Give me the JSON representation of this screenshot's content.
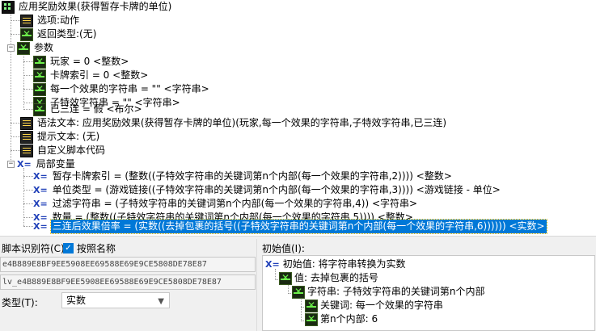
{
  "tree": {
    "function": "应用奖励效果(获得暂存卡牌的单位)",
    "option": "选项:动作",
    "return_type": "返回类型:(无)",
    "params_header": "参数",
    "params": [
      "玩家 = 0 <整数>",
      "卡牌索引 = 0 <整数>",
      "每一个效果的字符串 = \"\" <字符串>",
      "子特效字符串 = \"\" <字符串>",
      "已三连 = 假 <布尔>"
    ],
    "syntax": "语法文本: 应用奖励效果(获得暂存卡牌的单位)(玩家,每一个效果的字符串,子特效字符串,已三连)",
    "hint": "提示文本: (无)",
    "custom_script": "自定义脚本代码",
    "locals_header": "局部变量",
    "locals": [
      "暂存卡牌索引 = (整数((子特效字符串的关键词第n个内部(每一个效果的字符串,2)))) <整数>",
      "单位类型 = (游戏链接((子特效字符串的关键词第n个内部(每一个效果的字符串,3)))) <游戏链接 - 单位>",
      "过滤字符串 = (子特效字符串的关键词第n个内部(每一个效果的字符串,4)) <字符串>",
      "数量 = (整数((子特效字符串的关键词第n个内部(每一个效果的字符串,5)))) <整数>",
      "三连后效果倍率 = (实数((去掉包裹的括号((子特效字符串的关键词第n个内部(每一个效果的字符串,6)))))) <实数>"
    ],
    "xeq": "X="
  },
  "left": {
    "script_id_label": "脚本识别符(C):",
    "by_name_label": "按照名称",
    "id_value": "e4B889E8BF9EE5908EE69588E69E9CE5808DE78E87",
    "lv_value": "lv_e4B889E8BF9EE5908EE69588E69E9CE5808DE78E87",
    "type_label": "类型(T):",
    "type_value": "实数"
  },
  "right": {
    "initial_label": "初始值(I):",
    "rows": [
      "初始值: 将字符串转换为实数",
      "值: 去掉包裹的括号",
      "字符串: 子特效字符串的关键词第n个内部",
      "关键词: 每一个效果的字符串",
      "第n个内部: 6"
    ]
  },
  "colors": {
    "selection": "#0078d7",
    "xeq": "#1f3fb8",
    "panel": "#f0f0f0"
  }
}
